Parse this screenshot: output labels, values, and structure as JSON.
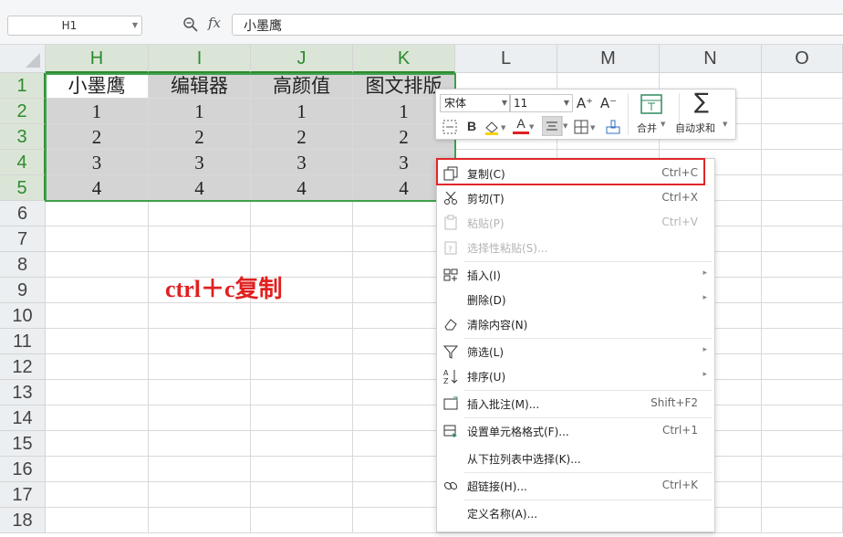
{
  "formula_bar": {
    "cell_ref": "H1",
    "fx_label": "fx",
    "content": "小墨鹰"
  },
  "columns": [
    "H",
    "I",
    "J",
    "K",
    "L",
    "M",
    "N",
    "O"
  ],
  "rows": [
    "1",
    "2",
    "3",
    "4",
    "5",
    "6",
    "7",
    "8",
    "9",
    "10",
    "11",
    "12",
    "13",
    "14",
    "15",
    "16",
    "17",
    "18"
  ],
  "table": {
    "header": [
      "小墨鹰",
      "编辑器",
      "高颜值",
      "图文排版"
    ],
    "body": [
      [
        "1",
        "1",
        "1",
        "1"
      ],
      [
        "2",
        "2",
        "2",
        "2"
      ],
      [
        "3",
        "3",
        "3",
        "3"
      ],
      [
        "4",
        "4",
        "4",
        "4"
      ]
    ]
  },
  "annotation": "ctrl＋c复制",
  "mini_toolbar": {
    "font_name": "宋体",
    "font_size": "11",
    "merge_label": "合并",
    "autosum_label": "自动求和",
    "bold_label": "B",
    "font_color_label": "A",
    "grow_label": "A⁺",
    "shrink_label": "A⁻"
  },
  "context_menu": {
    "items": [
      {
        "label": "复制(C)",
        "shortcut": "Ctrl+C",
        "icon": "copy-icon"
      },
      {
        "label": "剪切(T)",
        "shortcut": "Ctrl+X",
        "icon": "scissors-icon"
      },
      {
        "label": "粘贴(P)",
        "shortcut": "Ctrl+V",
        "icon": "paste-icon",
        "disabled": true
      },
      {
        "label": "选择性粘贴(S)...",
        "shortcut": "",
        "icon": "paste-special-icon",
        "disabled": true
      },
      {
        "label": "插入(I)",
        "shortcut": "",
        "icon": "insert-icon",
        "submenu": true
      },
      {
        "label": "删除(D)",
        "shortcut": "",
        "icon": "",
        "submenu": true
      },
      {
        "label": "清除内容(N)",
        "shortcut": "",
        "icon": "eraser-icon"
      },
      {
        "label": "筛选(L)",
        "shortcut": "",
        "icon": "filter-icon",
        "submenu": true
      },
      {
        "label": "排序(U)",
        "shortcut": "",
        "icon": "sort-icon",
        "submenu": true
      },
      {
        "label": "插入批注(M)...",
        "shortcut": "Shift+F2",
        "icon": "comment-icon"
      },
      {
        "label": "设置单元格格式(F)...",
        "shortcut": "Ctrl+1",
        "icon": "format-cells-icon"
      },
      {
        "label": "从下拉列表中选择(K)...",
        "shortcut": "",
        "icon": ""
      },
      {
        "label": "超链接(H)...",
        "shortcut": "Ctrl+K",
        "icon": "link-icon"
      },
      {
        "label": "定义名称(A)...",
        "shortcut": "",
        "icon": ""
      }
    ]
  },
  "colors": {
    "selection_border": "#3fa14a",
    "highlight_box": "#e0262b",
    "annotation": "#e02020"
  }
}
